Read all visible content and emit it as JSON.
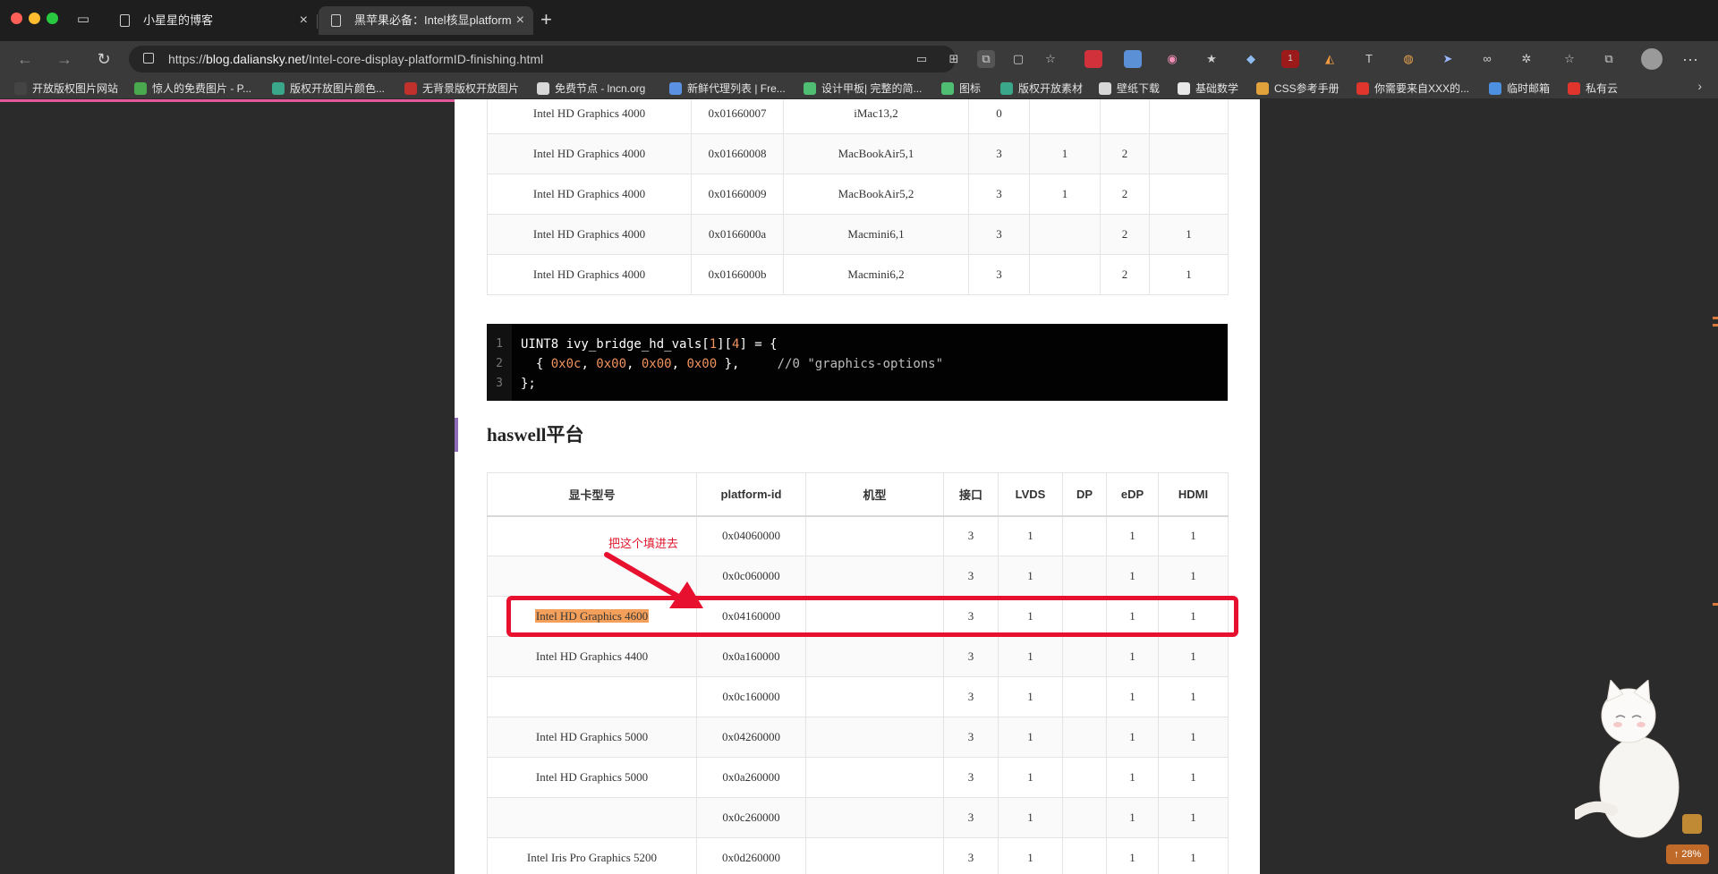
{
  "browser": {
    "tabs": [
      {
        "title": "小星星的博客",
        "active": false
      },
      {
        "title": "黑苹果必备：Intel核显platform",
        "active": true
      }
    ],
    "url_prefix": "https://",
    "url_domain": "blog.daliansky.net",
    "url_path": "/Intel-core-display-platformID-finishing.html",
    "bookmarks": [
      "开放版权图片网站",
      "惊人的免费图片 - P...",
      "版权开放图片颜色...",
      "无背景版权开放图片",
      "免费节点 - lncn.org",
      "新鲜代理列表 | Fre...",
      "设计甲板| 完整的简...",
      "图标",
      "版权开放素材",
      "壁纸下载",
      "基础数学",
      "CSS参考手册",
      "你需要来自XXX的...",
      "临时邮箱",
      "私有云"
    ],
    "extension_badge": "1"
  },
  "ivy_table": {
    "rows": [
      [
        "Intel HD Graphics 4000",
        "0x01660007",
        "iMac13,2",
        "0",
        "",
        "",
        ""
      ],
      [
        "Intel HD Graphics 4000",
        "0x01660008",
        "MacBookAir5,1",
        "3",
        "1",
        "2",
        ""
      ],
      [
        "Intel HD Graphics 4000",
        "0x01660009",
        "MacBookAir5,2",
        "3",
        "1",
        "2",
        ""
      ],
      [
        "Intel HD Graphics 4000",
        "0x0166000a",
        "Macmini6,1",
        "3",
        "",
        "2",
        "1"
      ],
      [
        "Intel HD Graphics 4000",
        "0x0166000b",
        "Macmini6,2",
        "3",
        "",
        "2",
        "1"
      ]
    ]
  },
  "code": {
    "line_numbers": [
      "1",
      "2",
      "3"
    ],
    "line1_pre": "UINT8 ivy_bridge_hd_vals[",
    "line1_n1": "1",
    "line1_mid": "][",
    "line1_n2": "4",
    "line1_post": "] = {",
    "line2_pre": "  { ",
    "line2_v1": "0x0c",
    "line2_v2": "0x00",
    "line2_v3": "0x00",
    "line2_v4": "0x00",
    "line2_post": " },     ",
    "line2_comment": "//0 \"graphics-options\"",
    "line3": "};"
  },
  "haswell": {
    "heading": "haswell平台",
    "headers": [
      "显卡型号",
      "platform-id",
      "机型",
      "接口",
      "LVDS",
      "DP",
      "eDP",
      "HDMI"
    ],
    "rows": [
      [
        "",
        "0x04060000",
        "",
        "3",
        "1",
        "",
        "1",
        "1"
      ],
      [
        "",
        "0x0c060000",
        "",
        "3",
        "1",
        "",
        "1",
        "1"
      ],
      [
        "Intel HD Graphics 4600",
        "0x04160000",
        "",
        "3",
        "1",
        "",
        "1",
        "1"
      ],
      [
        "Intel HD Graphics 4400",
        "0x0a160000",
        "",
        "3",
        "1",
        "",
        "1",
        "1"
      ],
      [
        "",
        "0x0c160000",
        "",
        "3",
        "1",
        "",
        "1",
        "1"
      ],
      [
        "Intel HD Graphics 5000",
        "0x04260000",
        "",
        "3",
        "1",
        "",
        "1",
        "1"
      ],
      [
        "Intel HD Graphics 5000",
        "0x0a260000",
        "",
        "3",
        "1",
        "",
        "1",
        "1"
      ],
      [
        "",
        "0x0c260000",
        "",
        "3",
        "1",
        "",
        "1",
        "1"
      ],
      [
        "Intel Iris Pro Graphics 5200",
        "0x0d260000",
        "",
        "3",
        "1",
        "",
        "1",
        "1"
      ]
    ]
  },
  "annotation": {
    "text": "把这个填进去",
    "color": "#e8102f"
  },
  "widgets": {
    "scroll_percent": "28%"
  }
}
